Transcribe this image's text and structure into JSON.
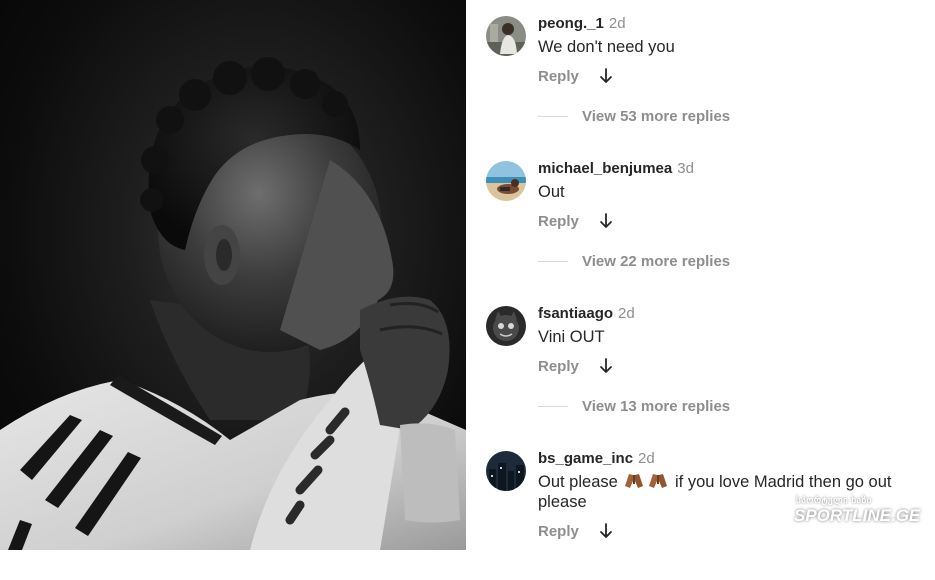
{
  "comments": [
    {
      "username": "peong._1",
      "time": "2d",
      "text": "We don't need you",
      "reply_label": "Reply",
      "view_more": "View 53 more replies",
      "avatar_icon": "person-sitting-avatar"
    },
    {
      "username": "michael_benjumea",
      "time": "3d",
      "text": "Out",
      "reply_label": "Reply",
      "view_more": "View 22 more replies",
      "avatar_icon": "beach-avatar"
    },
    {
      "username": "fsantiaago",
      "time": "2d",
      "text": "Vini OUT",
      "reply_label": "Reply",
      "view_more": "View 13 more replies",
      "avatar_icon": "dark-cat-avatar"
    },
    {
      "username": "bs_game_inc",
      "time": "2d",
      "text_before_emoji": "Out please",
      "text_after_emoji": "if you love Madrid then go out please",
      "emoji": "folded-hands-icon",
      "reply_label": "Reply",
      "avatar_icon": "night-city-avatar"
    }
  ],
  "watermark": {
    "top_text": "სპორტული ხაზი",
    "main_text": "SPORTLINE.GE"
  },
  "colors": {
    "username": "#262626",
    "muted": "#8e8e8e",
    "background": "#ffffff"
  }
}
